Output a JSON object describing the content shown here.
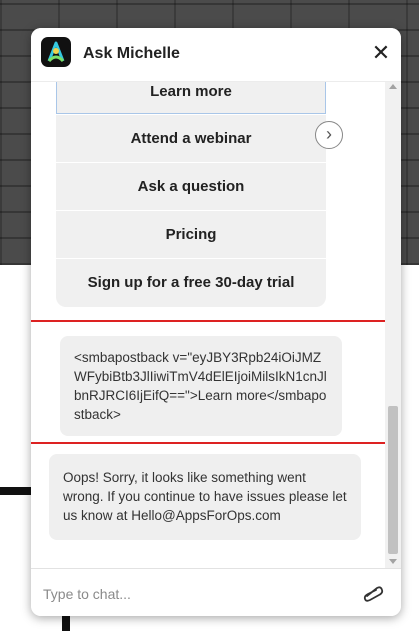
{
  "header": {
    "title": "Ask Michelle",
    "close_icon": "close-icon",
    "close_glyph": "✕"
  },
  "menu": {
    "items": [
      {
        "label": "Learn more"
      },
      {
        "label": "Attend a webinar"
      },
      {
        "label": "Ask a question"
      },
      {
        "label": "Pricing"
      },
      {
        "label": "Sign up for a free 30-day trial"
      }
    ],
    "next_glyph": "›"
  },
  "messages": [
    {
      "text": "<smbapostback v=\"eyJBY3Rpb24iOiJMZWFybiBtb3JlIiwiTmV4dElEIjoiMilsIkN1cnJlbnRJRCI6IjEifQ==\">Learn more</smbapostback>"
    },
    {
      "text": "Oops! Sorry, it looks like something went wrong. If you continue to have issues please let us know at Hello@AppsForOps.com"
    }
  ],
  "composer": {
    "placeholder": "Type to chat...",
    "attach_icon": "paperclip-icon"
  },
  "colors": {
    "highlight": "#dd2222",
    "logo_accent": "#35c9e0",
    "bubble_bg": "#efefef"
  }
}
